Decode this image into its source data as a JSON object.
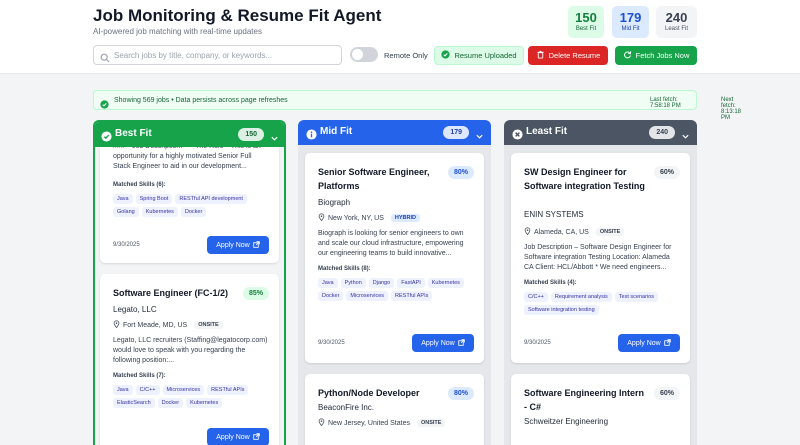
{
  "header": {
    "title": "Job Monitoring & Resume Fit Agent",
    "subtitle": "AI-powered job matching with real-time updates"
  },
  "stats": [
    {
      "value": "150",
      "label": "Best Fit"
    },
    {
      "value": "179",
      "label": "Mid Fit"
    },
    {
      "value": "240",
      "label": "Least Fit"
    }
  ],
  "search": {
    "placeholder": "Search jobs by title, company, or keywords...",
    "value": ""
  },
  "remote_only": {
    "label": "Remote Only",
    "enabled": false
  },
  "buttons": {
    "resume_uploaded": "Resume Uploaded",
    "delete_resume": "Delete Resume",
    "fetch_jobs": "Fetch Jobs Now"
  },
  "status_banner": {
    "message": "Showing 569 jobs • Data persists across page refreshes",
    "last_fetch": "Last fetch: 7:58:18 PM",
    "next_fetch": "Next fetch: 8:13:18 PM"
  },
  "columns": [
    {
      "title": "Best Fit",
      "count": "150",
      "accent": "#16a34a",
      "cards": [
        {
          "desc": "### **Job Description:** **The Role** This is an opportunity for a highly motivated Senior Full Stack Engineer to aid in our development...",
          "skills_heading": "Matched Skills (6):",
          "skills": [
            "Java",
            "Spring Boot",
            "RESTful API development",
            "Golang",
            "Kubernetes",
            "Docker"
          ],
          "date": "9/30/2025",
          "apply": "Apply Now"
        },
        {
          "title": "Software Engineer (FC-1/2)",
          "pct": "85%",
          "company": "Legato, LLC",
          "location": "Fort Meade, MD, US",
          "work_type": "ONSITE",
          "desc": "Legato, LLC recruiters (Staffing@legatocorp.com) would love to speak with you regarding the following position:...",
          "skills_heading": "Matched Skills (7):",
          "skills": [
            "Java",
            "C/C++",
            "Microservices",
            "RESTful APIs",
            "ElasticSearch",
            "Docker",
            "Kubernetes"
          ],
          "apply": "Apply Now"
        }
      ]
    },
    {
      "title": "Mid Fit",
      "count": "179",
      "accent": "#2563eb",
      "cards": [
        {
          "title": "Senior Software Engineer, Platforms",
          "pct": "80%",
          "company": "Biograph",
          "location": "New York, NY, US",
          "work_type": "HYBRID",
          "desc": "Biograph is looking for senior engineers to own and scale our cloud infrastructure, empowering our engineering teams to build innovative...",
          "skills_heading": "Matched Skills (8):",
          "skills": [
            "Java",
            "Python",
            "Django",
            "FastAPI",
            "Kubernetes",
            "Docker",
            "Microservices",
            "RESTful APIs"
          ],
          "date": "9/30/2025",
          "apply": "Apply Now"
        },
        {
          "title": "Python/Node Developer",
          "pct": "80%",
          "company": "BeaconFire Inc.",
          "location": "New Jersey, United States",
          "work_type": "ONSITE"
        }
      ]
    },
    {
      "title": "Least Fit",
      "count": "240",
      "accent": "#4b5563",
      "cards": [
        {
          "title": "SW Design Engineer for Software integration Testing",
          "pct": "60%",
          "company": "ENIN SYSTEMS",
          "location": "Alameda, CA, US",
          "work_type": "ONSITE",
          "desc": "Job Description – Software Design Engineer for Software integration Testing Location: Alameda CA Client: HCL/Abbott * We need engineers...",
          "skills_heading": "Matched Skills (4):",
          "skills": [
            "C/C++",
            "Requirement analysis",
            "Test scenarios",
            "Software integration testing"
          ],
          "date": "9/30/2025",
          "apply": "Apply Now"
        },
        {
          "title": "Software Engineering Intern - C#",
          "pct": "60%",
          "company": "Schweitzer Engineering"
        }
      ]
    }
  ]
}
